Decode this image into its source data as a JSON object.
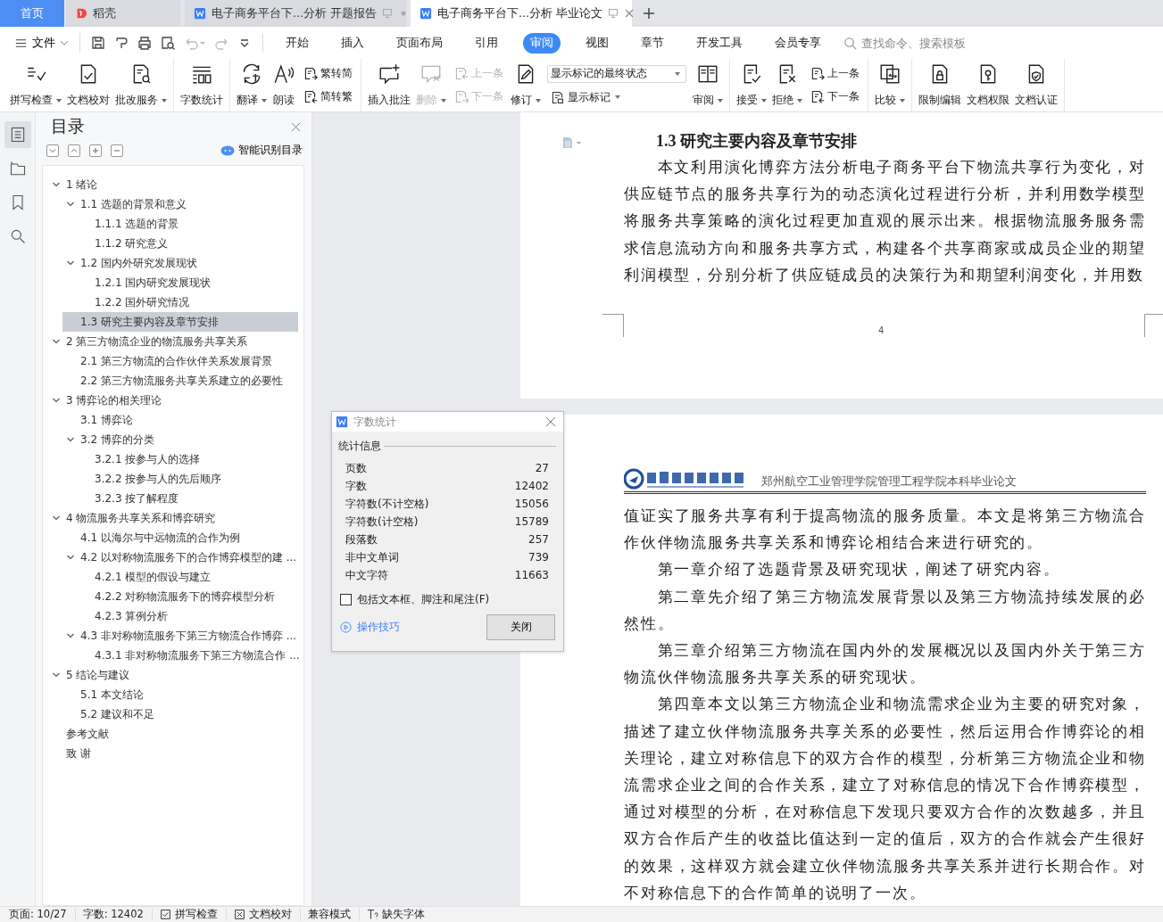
{
  "tabs": [
    {
      "label": "首页",
      "kind": "home",
      "selected": false
    },
    {
      "label": "稻壳",
      "kind": "store",
      "selected": false
    },
    {
      "label": "电子商务平台下...分析 开题报告",
      "kind": "doc",
      "selected": false
    },
    {
      "label": "电子商务平台下...分析 毕业论文",
      "kind": "doc",
      "selected": true
    }
  ],
  "menu": {
    "file": "文件",
    "tabs": [
      {
        "label": "开始",
        "selected": false
      },
      {
        "label": "插入",
        "selected": false
      },
      {
        "label": "页面布局",
        "selected": false
      },
      {
        "label": "引用",
        "selected": false
      },
      {
        "label": "审阅",
        "selected": true
      },
      {
        "label": "视图",
        "selected": false
      },
      {
        "label": "章节",
        "selected": false
      },
      {
        "label": "开发工具",
        "selected": false
      },
      {
        "label": "会员专享",
        "selected": false
      }
    ],
    "search": {
      "placeholder": "查找命令、搜索模板"
    }
  },
  "ribbon": {
    "groups": [
      [
        {
          "kind": "big",
          "label": "拼写检查",
          "has_menu": true,
          "disabled": false
        },
        {
          "kind": "big",
          "label": "文档校对",
          "has_menu": false,
          "disabled": false
        },
        {
          "kind": "big",
          "label": "批改服务",
          "has_menu": true,
          "disabled": false
        }
      ],
      [
        {
          "kind": "big",
          "label": "字数统计",
          "has_menu": false,
          "disabled": false
        }
      ],
      [
        {
          "kind": "big",
          "label": "翻译",
          "has_menu": true,
          "disabled": false
        },
        {
          "kind": "big",
          "label": "朗读",
          "has_menu": false,
          "disabled": false
        },
        {
          "kind": "pair",
          "rows": [
            {
              "label": "繁转简",
              "disabled": false
            },
            {
              "label": "简转繁",
              "disabled": false
            }
          ]
        }
      ],
      [
        {
          "kind": "big",
          "label": "插入批注",
          "has_menu": false,
          "disabled": false
        },
        {
          "kind": "big",
          "label": "删除",
          "has_menu": true,
          "disabled": true
        },
        {
          "kind": "pair",
          "rows": [
            {
              "label": "上一条",
              "disabled": true
            },
            {
              "label": "下一条",
              "disabled": true
            }
          ]
        },
        {
          "kind": "big",
          "label": "修订",
          "has_menu": true,
          "disabled": false
        },
        {
          "kind": "select",
          "value": "显示标记的最终状态",
          "button": "显示标记"
        },
        {
          "kind": "big",
          "label": "审阅",
          "has_menu": true,
          "disabled": false
        }
      ],
      [
        {
          "kind": "big",
          "label": "接受",
          "has_menu": true,
          "disabled": false
        },
        {
          "kind": "big",
          "label": "拒绝",
          "has_menu": true,
          "disabled": false
        },
        {
          "kind": "pair",
          "rows": [
            {
              "label": "上一条",
              "disabled": false
            },
            {
              "label": "下一条",
              "disabled": false
            }
          ]
        }
      ],
      [
        {
          "kind": "big",
          "label": "比较",
          "has_menu": true,
          "disabled": false
        }
      ],
      [
        {
          "kind": "big",
          "label": "限制编辑",
          "has_menu": false,
          "disabled": false
        },
        {
          "kind": "big",
          "label": "文档权限",
          "has_menu": false,
          "disabled": false
        },
        {
          "kind": "big",
          "label": "文档认证",
          "has_menu": false,
          "disabled": false
        }
      ]
    ]
  },
  "sidebar": {
    "items": [
      {
        "selected": true
      },
      {
        "selected": false
      },
      {
        "selected": false
      },
      {
        "selected": false
      }
    ]
  },
  "toc": {
    "title": "目录",
    "smart_button": "智能识别目录",
    "items": [
      {
        "label": "1 绪论",
        "expanded": true,
        "selected": false,
        "children": [
          {
            "label": "1.1 选题的背景和意义",
            "expanded": true,
            "selected": false,
            "children": [
              {
                "label": "1.1.1 选题的背景",
                "selected": false
              },
              {
                "label": "1.1.2 研究意义",
                "selected": false
              }
            ]
          },
          {
            "label": "1.2 国内外研究发展现状",
            "expanded": true,
            "selected": false,
            "children": [
              {
                "label": "1.2.1 国内研究发展现状",
                "selected": false
              },
              {
                "label": "1.2.2 国外研究情况",
                "selected": false
              }
            ]
          },
          {
            "label": "1.3 研究主要内容及章节安排",
            "selected": true
          }
        ]
      },
      {
        "label": "2 第三方物流企业的物流服务共享关系",
        "expanded": true,
        "selected": false,
        "children": [
          {
            "label": "2.1 第三方物流的合作伙伴关系发展背景",
            "selected": false
          },
          {
            "label": "2.2 第三方物流服务共享关系建立的必要性",
            "selected": false
          }
        ]
      },
      {
        "label": "3 博弈论的相关理论",
        "expanded": true,
        "selected": false,
        "children": [
          {
            "label": "3.1 博弈论",
            "selected": false
          },
          {
            "label": "3.2 博弈的分类",
            "expanded": true,
            "selected": false,
            "children": [
              {
                "label": "3.2.1 按参与人的选择",
                "selected": false
              },
              {
                "label": "3.2.2 按参与人的先后顺序",
                "selected": false
              },
              {
                "label": "3.2.3 按了解程度",
                "selected": false
              }
            ]
          }
        ]
      },
      {
        "label": "4 物流服务共享关系和博弈研究",
        "expanded": true,
        "selected": false,
        "children": [
          {
            "label": "4.1 以海尔与中远物流的合作为例",
            "selected": false
          },
          {
            "label": "4.2 以对称物流服务下的合作博弈模型的建 ...",
            "expanded": true,
            "selected": false,
            "children": [
              {
                "label": "4.2.1 模型的假设与建立",
                "selected": false
              },
              {
                "label": "4.2.2 对称物流服务下的博弈模型分析",
                "selected": false
              },
              {
                "label": "4.2.3 算例分析",
                "selected": false
              }
            ]
          },
          {
            "label": "4.3 非对称物流服务下第三方物流合作博弈 ...",
            "expanded": true,
            "selected": false,
            "children": [
              {
                "label": "4.3.1 非对称物流服务下第三方物流合作 ...",
                "selected": false
              }
            ]
          }
        ]
      },
      {
        "label": "5 结论与建议",
        "expanded": true,
        "selected": false,
        "children": [
          {
            "label": "5.1 本文结论",
            "selected": false
          },
          {
            "label": "5.2 建议和不足",
            "selected": false
          }
        ]
      },
      {
        "label": "参考文献",
        "selected": false
      },
      {
        "label": "致  谢",
        "selected": false
      }
    ]
  },
  "document": {
    "pages": [
      {
        "heading": "1.3 研究主要内容及章节安排",
        "paragraphs": [
          {
            "indent": true,
            "text": "本文利用演化博弈方法分析电子商务平台下物流共享行为变化，对供应链节点的服务共享行为的动态演化过程进行分析，并利用数学模型将服务共享策略的演化过程更加直观的展示出来。根据物流服务服务需求信息流动方向和服务共享方式，构建各个共享商家或成员企业的期望利润模型，分别分析了供应链成员的决策行为和期望利润变化，并用数"
          }
        ],
        "page_number": "4"
      },
      {
        "header": "郑州航空工业管理学院管理工程学院本科毕业论文",
        "paragraphs": [
          {
            "indent": false,
            "text": "值证实了服务共享有利于提高物流的服务质量。本文是将第三方物流合作伙伴物流服务共享关系和博弈论相结合来进行研究的。"
          },
          {
            "indent": true,
            "text": "第一章介绍了选题背景及研究现状，阐述了研究内容。"
          },
          {
            "indent": true,
            "text": "第二章先介绍了第三方物流发展背景以及第三方物流持续发展的必然性。"
          },
          {
            "indent": true,
            "text": "第三章介绍第三方物流在国内外的发展概况以及国内外关于第三方物流伙伴物流服务共享关系的研究现状。"
          },
          {
            "indent": true,
            "text": "第四章本文以第三方物流企业和物流需求企业为主要的研究对象，描述了建立伙伴物流服务共享关系的必要性，然后运用合作博弈论的相关理论，建立对称信息下的双方合作的模型，分析第三方物流企业和物流需求企业之间的合作关系，建立了对称信息的情况下合作博弈模型，通过对模型的分析，在对称信息下发现只要双方合作的次数越多，并且双方合作后产生的收益比值达到一定的值后，双方的合作就会产生很好的效果，这样双方就会建立伙伴物流服务共享关系并进行长期合作。对不对称信息下的合作简单的说明了一次。"
          }
        ]
      }
    ]
  },
  "dialog": {
    "title": "字数统计",
    "section": "统计信息",
    "rows": [
      {
        "label": "页数",
        "value": "27"
      },
      {
        "label": "字数",
        "value": "12402"
      },
      {
        "label": "字符数(不计空格)",
        "value": "15056"
      },
      {
        "label": "字符数(计空格)",
        "value": "15789"
      },
      {
        "label": "段落数",
        "value": "257"
      },
      {
        "label": "非中文单词",
        "value": "739"
      },
      {
        "label": "中文字符",
        "value": "11663"
      }
    ],
    "checkbox": {
      "label": "包括文本框、脚注和尾注(F)",
      "checked": false
    },
    "tips_link": "操作技巧",
    "close_button": "关闭"
  },
  "status_bar": {
    "page": "页面: 10/27",
    "words": "字数: 12402",
    "items": [
      {
        "kind": "spell",
        "label": "拼写检查"
      },
      {
        "kind": "proofread",
        "label": "文档校对"
      },
      {
        "kind": "plain",
        "label": "兼容模式"
      },
      {
        "kind": "font",
        "label": "缺失字体"
      }
    ]
  }
}
